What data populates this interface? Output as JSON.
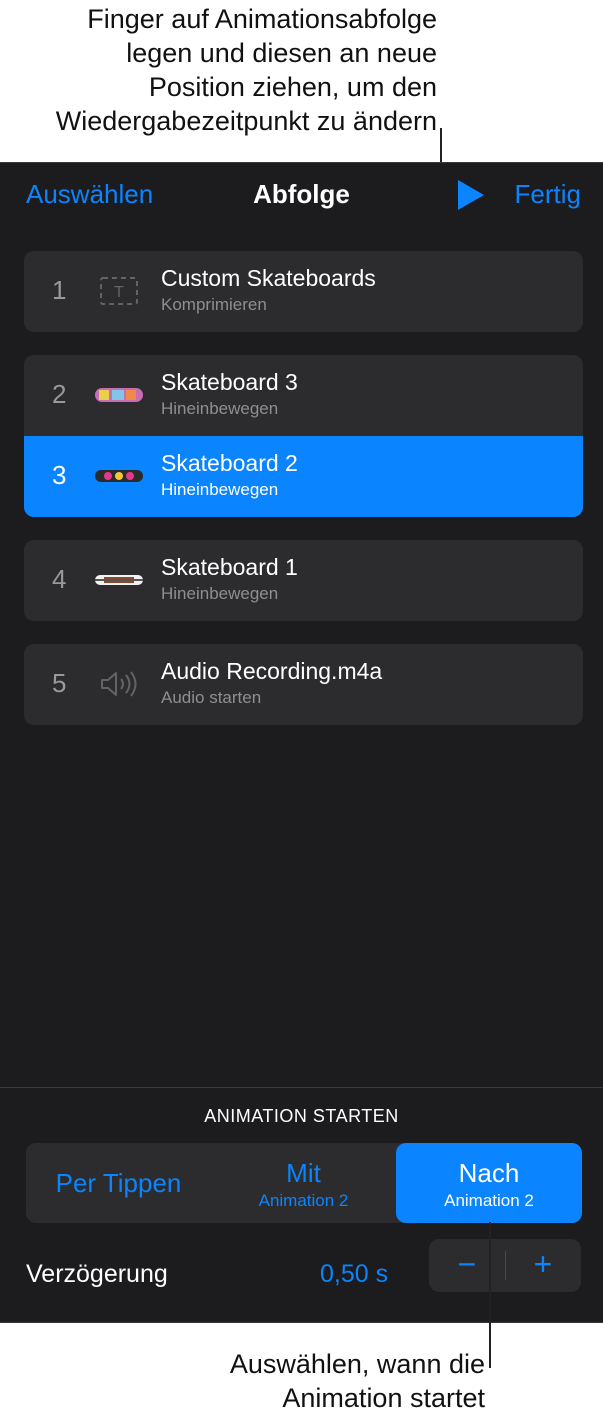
{
  "callouts": {
    "top": [
      "Finger auf Animationsabfolge",
      "legen und diesen an neue",
      "Position ziehen, um den",
      "Wiedergabezeitpunkt zu ändern"
    ],
    "bottom": [
      "Auswählen, wann die",
      "Animation startet"
    ]
  },
  "header": {
    "left": "Auswählen",
    "title": "Abfolge",
    "play_icon": "play-icon",
    "right": "Fertig"
  },
  "items": [
    {
      "num": "1",
      "title": "Custom Skateboards",
      "sub": "Komprimieren",
      "icon": "text-box-icon"
    },
    {
      "num": "2",
      "title": "Skateboard 3",
      "sub": "Hineinbewegen",
      "icon": "skateboard-thumbnail"
    },
    {
      "num": "3",
      "title": "Skateboard 2",
      "sub": "Hineinbewegen",
      "icon": "skateboard-thumbnail"
    },
    {
      "num": "4",
      "title": "Skateboard 1",
      "sub": "Hineinbewegen",
      "icon": "skateboard-thumbnail"
    },
    {
      "num": "5",
      "title": "Audio Recording.m4a",
      "sub": "Audio starten",
      "icon": "speaker-icon"
    }
  ],
  "start_section": {
    "label": "ANIMATION STARTEN",
    "options": [
      {
        "main": "Per Tippen",
        "sub": ""
      },
      {
        "main": "Mit",
        "sub": "Animation 2"
      },
      {
        "main": "Nach",
        "sub": "Animation 2"
      }
    ],
    "selected": "Nach"
  },
  "delay": {
    "label": "Verzögerung",
    "value": "0,50 s",
    "minus": "−",
    "plus": "+"
  },
  "colors": {
    "accent": "#0a84ff",
    "panel": "#1c1c1e",
    "row": "#2c2c2e"
  }
}
